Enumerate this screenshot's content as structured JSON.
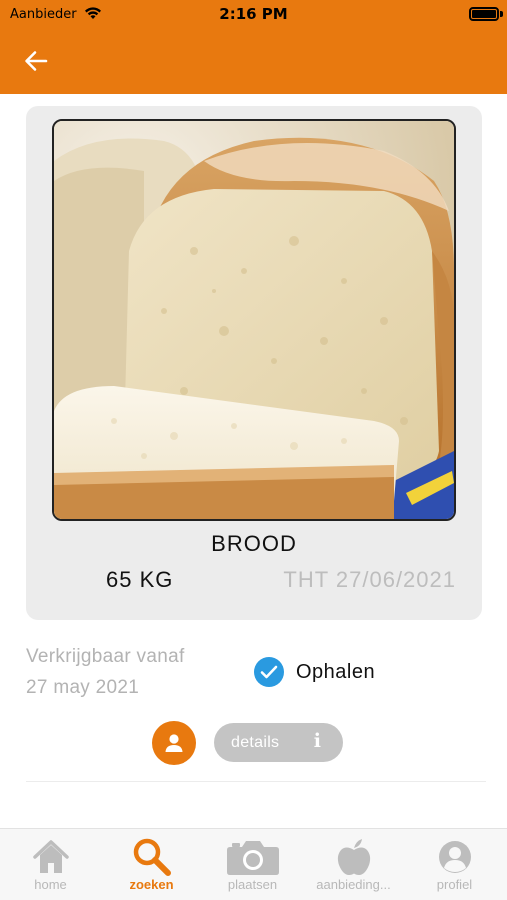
{
  "status_bar": {
    "carrier": "Aanbieder",
    "time": "2:16 PM"
  },
  "nav": {
    "back_icon": "arrow-left-icon"
  },
  "product": {
    "name": "BROOD",
    "weight": "65 KG",
    "tht": "THT 27/06/2021",
    "image": "bread-photo"
  },
  "availability": {
    "label": "Verkrijgbaar vanaf",
    "date": "27 may 2021"
  },
  "pickup": {
    "label": "Ophalen",
    "checked": true
  },
  "actions": {
    "details_label": "details",
    "info_glyph": "i"
  },
  "tabs": [
    {
      "label": "home",
      "icon": "home-icon",
      "active": false
    },
    {
      "label": "zoeken",
      "icon": "search-icon",
      "active": true
    },
    {
      "label": "plaatsen",
      "icon": "camera-icon",
      "active": false
    },
    {
      "label": "aanbieding...",
      "icon": "apple-icon",
      "active": false
    },
    {
      "label": "profiel",
      "icon": "profile-icon",
      "active": false
    }
  ],
  "colors": {
    "brand_orange": "#e8790f",
    "check_blue": "#2a9ae0",
    "muted_gray": "#b3b3b3"
  }
}
